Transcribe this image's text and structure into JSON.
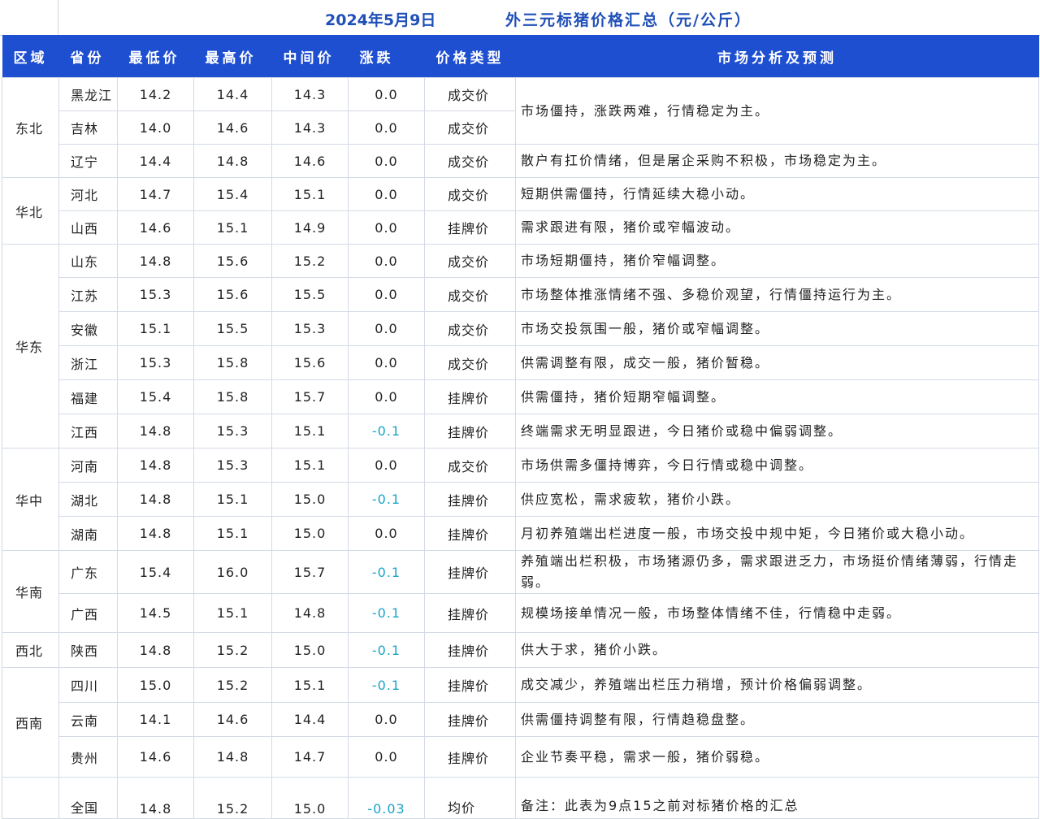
{
  "title": {
    "date": "2024年5月9日",
    "text": "外三元标猪价格汇总（元/公斤）"
  },
  "headers": {
    "region": "区域",
    "province": "省份",
    "min": "最低价",
    "max": "最高价",
    "mid": "中间价",
    "change": "涨跌",
    "price_type": "价格类型",
    "analysis": "市场分析及预测"
  },
  "rows": [
    {
      "region": "东北",
      "province": "黑龙江",
      "min": "14.2",
      "max": "14.4",
      "mid": "14.3",
      "change": "0.0",
      "price_type": "成交价",
      "analysis": "市场僵持，涨跌两难，行情稳定为主。"
    },
    {
      "region": "东北",
      "province": "吉林",
      "min": "14.0",
      "max": "14.6",
      "mid": "14.3",
      "change": "0.0",
      "price_type": "成交价",
      "analysis": "市场僵持，涨跌两难，行情稳定为主。"
    },
    {
      "region": "东北",
      "province": "辽宁",
      "min": "14.4",
      "max": "14.8",
      "mid": "14.6",
      "change": "0.0",
      "price_type": "成交价",
      "analysis": "散户有扛价情绪，但是屠企采购不积极，市场稳定为主。"
    },
    {
      "region": "华北",
      "province": "河北",
      "min": "14.7",
      "max": "15.4",
      "mid": "15.1",
      "change": "0.0",
      "price_type": "成交价",
      "analysis": "短期供需僵持，行情延续大稳小动。"
    },
    {
      "region": "华北",
      "province": "山西",
      "min": "14.6",
      "max": "15.1",
      "mid": "14.9",
      "change": "0.0",
      "price_type": "挂牌价",
      "analysis": "需求跟进有限，猪价或窄幅波动。"
    },
    {
      "region": "华东",
      "province": "山东",
      "min": "14.8",
      "max": "15.6",
      "mid": "15.2",
      "change": "0.0",
      "price_type": "成交价",
      "analysis": "市场短期僵持，猪价窄幅调整。"
    },
    {
      "region": "华东",
      "province": "江苏",
      "min": "15.3",
      "max": "15.6",
      "mid": "15.5",
      "change": "0.0",
      "price_type": "成交价",
      "analysis": "市场整体推涨情绪不强、多稳价观望，行情僵持运行为主。"
    },
    {
      "region": "华东",
      "province": "安徽",
      "min": "15.1",
      "max": "15.5",
      "mid": "15.3",
      "change": "0.0",
      "price_type": "成交价",
      "analysis": "市场交投氛围一般，猪价或窄幅调整。"
    },
    {
      "region": "华东",
      "province": "浙江",
      "min": "15.3",
      "max": "15.8",
      "mid": "15.6",
      "change": "0.0",
      "price_type": "成交价",
      "analysis": "供需调整有限，成交一般，猪价暂稳。"
    },
    {
      "region": "华东",
      "province": "福建",
      "min": "15.4",
      "max": "15.8",
      "mid": "15.7",
      "change": "0.0",
      "price_type": "挂牌价",
      "analysis": "供需僵持，猪价短期窄幅调整。"
    },
    {
      "region": "华东",
      "province": "江西",
      "min": "14.8",
      "max": "15.3",
      "mid": "15.1",
      "change": "-0.1",
      "price_type": "挂牌价",
      "analysis": "终端需求无明显跟进，今日猪价或稳中偏弱调整。"
    },
    {
      "region": "华中",
      "province": "河南",
      "min": "14.8",
      "max": "15.3",
      "mid": "15.1",
      "change": "0.0",
      "price_type": "成交价",
      "analysis": "市场供需多僵持博弈，今日行情或稳中调整。"
    },
    {
      "region": "华中",
      "province": "湖北",
      "min": "14.8",
      "max": "15.1",
      "mid": "15.0",
      "change": "-0.1",
      "price_type": "挂牌价",
      "analysis": "供应宽松，需求疲软，猪价小跌。"
    },
    {
      "region": "华中",
      "province": "湖南",
      "min": "14.8",
      "max": "15.1",
      "mid": "15.0",
      "change": "0.0",
      "price_type": "挂牌价",
      "analysis": "月初养殖端出栏进度一般，市场交投中规中矩，今日猪价或大稳小动。"
    },
    {
      "region": "华南",
      "province": "广东",
      "min": "15.4",
      "max": "16.0",
      "mid": "15.7",
      "change": "-0.1",
      "price_type": "挂牌价",
      "analysis": "养殖端出栏积极，市场猪源仍多，需求跟进乏力，市场挺价情绪薄弱，行情走弱。"
    },
    {
      "region": "华南",
      "province": "广西",
      "min": "14.5",
      "max": "15.1",
      "mid": "14.8",
      "change": "-0.1",
      "price_type": "挂牌价",
      "analysis": "规模场接单情况一般，市场整体情绪不佳，行情稳中走弱。"
    },
    {
      "region": "西北",
      "province": "陕西",
      "min": "14.8",
      "max": "15.2",
      "mid": "15.0",
      "change": "-0.1",
      "price_type": "挂牌价",
      "analysis": "供大于求，猪价小跌。"
    },
    {
      "region": "西南",
      "province": "四川",
      "min": "15.0",
      "max": "15.2",
      "mid": "15.1",
      "change": "-0.1",
      "price_type": "挂牌价",
      "analysis": "成交减少，养殖端出栏压力稍增，预计价格偏弱调整。"
    },
    {
      "region": "西南",
      "province": "云南",
      "min": "14.1",
      "max": "14.6",
      "mid": "14.4",
      "change": "0.0",
      "price_type": "挂牌价",
      "analysis": "供需僵持调整有限，行情趋稳盘整。"
    },
    {
      "region": "西南",
      "province": "贵州",
      "min": "14.6",
      "max": "14.8",
      "mid": "14.7",
      "change": "0.0",
      "price_type": "挂牌价",
      "analysis": "企业节奏平稳，需求一般，猪价弱稳。"
    }
  ],
  "total": {
    "region": "",
    "province": "全国",
    "min": "14.8",
    "max": "15.2",
    "mid": "15.0",
    "change": "-0.03",
    "price_type": "均价",
    "analysis": "备注：此表为9点15之前对标猪价格的汇总"
  },
  "colors": {
    "header_bg": "#1f4fd1",
    "title_text": "#1f4fb8",
    "negative_change": "#19a4c8",
    "grid": "#d3dbe6"
  }
}
